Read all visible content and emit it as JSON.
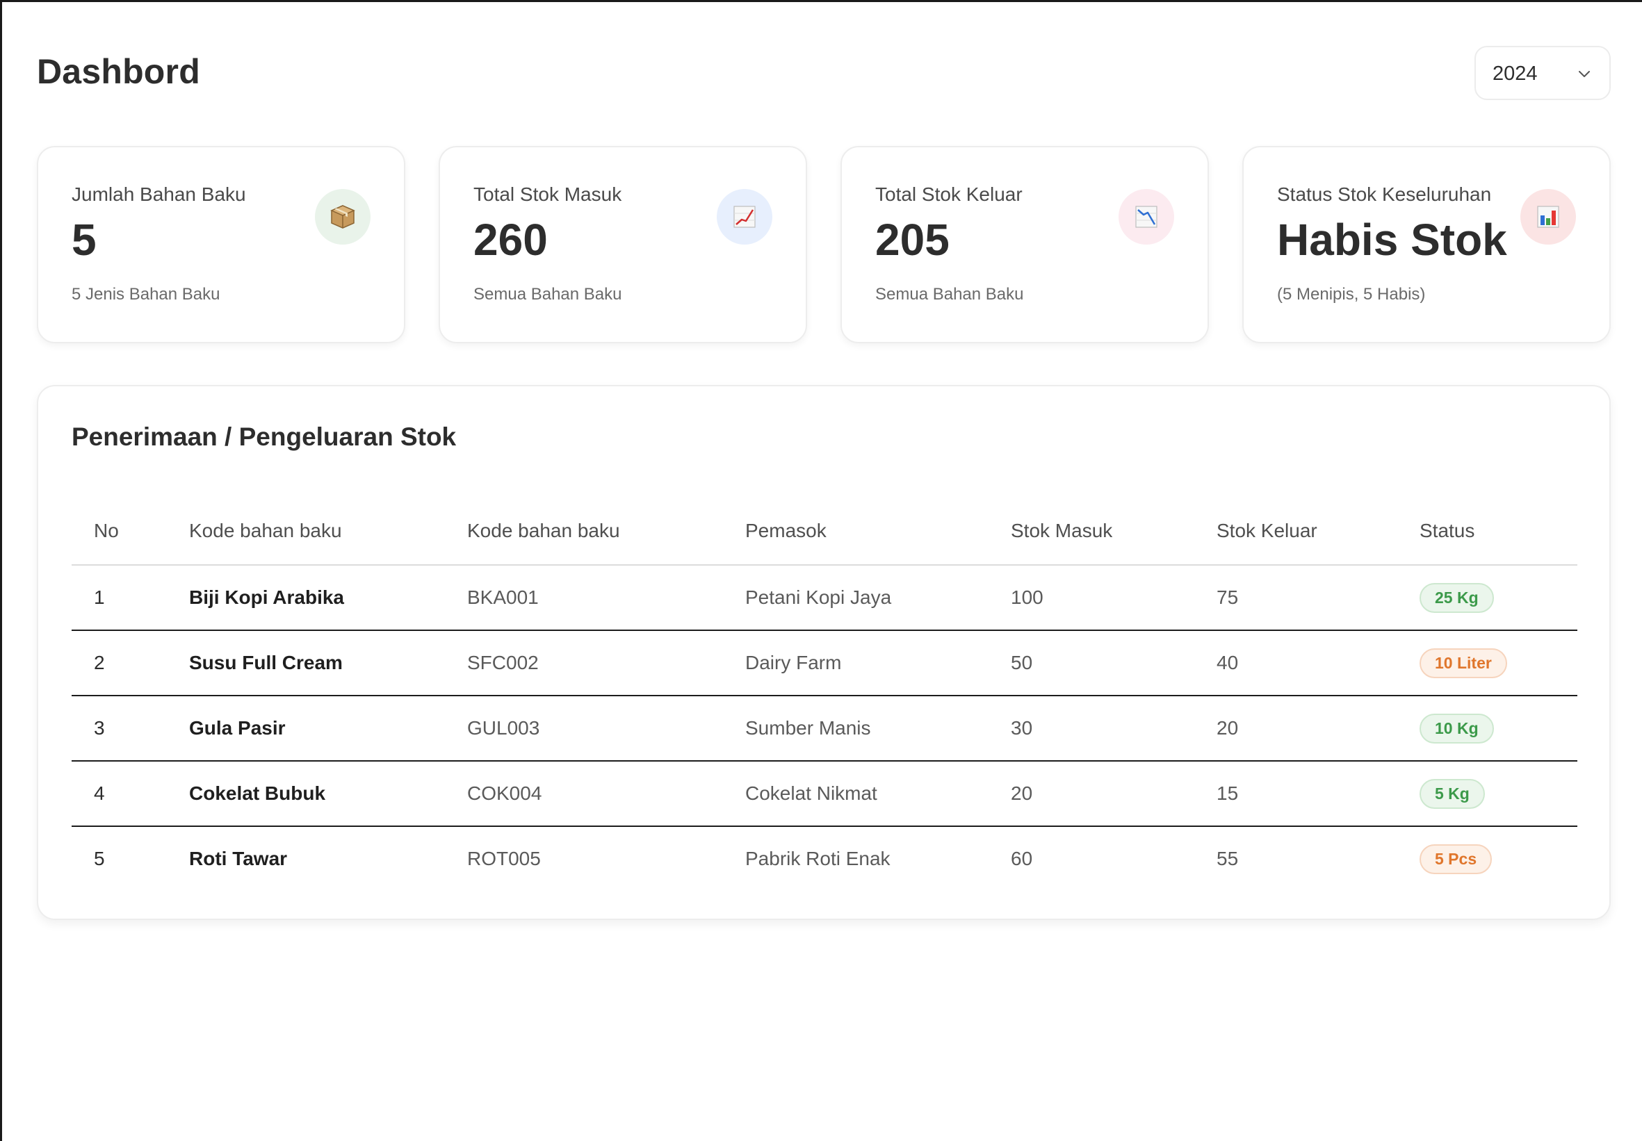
{
  "header": {
    "title": "Dashbord",
    "year_select": {
      "value": "2024"
    }
  },
  "cards": [
    {
      "label": "Jumlah Bahan Baku",
      "value": "5",
      "sub": "5 Jenis Bahan Baku",
      "icon": "package-icon",
      "icon_bg": "#e9f3ea"
    },
    {
      "label": "Total Stok Masuk",
      "value": "260",
      "sub": "Semua Bahan Baku",
      "icon": "chart-increasing-icon",
      "icon_bg": "#e7effd"
    },
    {
      "label": "Total Stok Keluar",
      "value": "205",
      "sub": "Semua Bahan Baku",
      "icon": "chart-decreasing-icon",
      "icon_bg": "#fcebf0"
    },
    {
      "label": "Status Stok Keseluruhan",
      "value": "Habis Stok",
      "sub": "(5 Menipis, 5 Habis)",
      "icon": "bar-chart-icon",
      "icon_bg": "#fbe4e4"
    }
  ],
  "stock_panel": {
    "title": "Penerimaan / Pengeluaran Stok",
    "columns": [
      "No",
      "Kode bahan baku",
      "Kode bahan baku",
      "Pemasok",
      "Stok Masuk",
      "Stok Keluar",
      "Status"
    ],
    "rows": [
      {
        "no": "1",
        "name": "Biji Kopi Arabika",
        "code": "BKA001",
        "supplier": "Petani Kopi Jaya",
        "in": "100",
        "out": "75",
        "status": "25 Kg",
        "status_color": "green"
      },
      {
        "no": "2",
        "name": "Susu Full Cream",
        "code": "SFC002",
        "supplier": "Dairy Farm",
        "in": "50",
        "out": "40",
        "status": "10 Liter",
        "status_color": "orange"
      },
      {
        "no": "3",
        "name": "Gula Pasir",
        "code": "GUL003",
        "supplier": "Sumber Manis",
        "in": "30",
        "out": "20",
        "status": "10 Kg",
        "status_color": "green"
      },
      {
        "no": "4",
        "name": "Cokelat Bubuk",
        "code": "COK004",
        "supplier": "Cokelat Nikmat",
        "in": "20",
        "out": "15",
        "status": "5 Kg",
        "status_color": "green"
      },
      {
        "no": "5",
        "name": "Roti Tawar",
        "code": "ROT005",
        "supplier": "Pabrik Roti Enak",
        "in": "60",
        "out": "55",
        "status": "5 Pcs",
        "status_color": "orange"
      }
    ]
  }
}
